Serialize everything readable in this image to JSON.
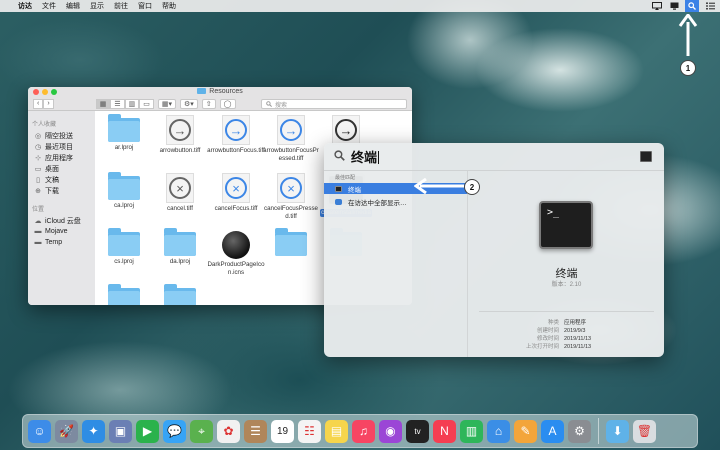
{
  "menubar": {
    "apple": "",
    "items": [
      "访达",
      "文件",
      "编辑",
      "显示",
      "前往",
      "窗口",
      "帮助"
    ]
  },
  "callouts": {
    "one": "1",
    "two": "2"
  },
  "finder": {
    "title": "Resources",
    "search_placeholder": "搜索",
    "sidebar": {
      "favorites_heading": "个人收藏",
      "favorites": [
        {
          "label": "隔空投送",
          "icon": "airdrop-icon"
        },
        {
          "label": "最近项目",
          "icon": "clock-icon"
        },
        {
          "label": "应用程序",
          "icon": "apps-icon"
        },
        {
          "label": "桌面",
          "icon": "desktop-icon"
        },
        {
          "label": "文稿",
          "icon": "document-icon"
        },
        {
          "label": "下载",
          "icon": "download-icon"
        }
      ],
      "locations_heading": "位置",
      "locations": [
        {
          "label": "iCloud 云盘",
          "icon": "cloud-icon"
        },
        {
          "label": "Mojave",
          "icon": "disk-icon"
        },
        {
          "label": "Temp",
          "icon": "disk-icon"
        }
      ]
    },
    "files": [
      {
        "label": "ar.lproj",
        "kind": "folder"
      },
      {
        "label": "arrowbutton.tiff",
        "kind": "tiff-gray"
      },
      {
        "label": "arrowbuttonFocus.tiff",
        "kind": "tiff-blue"
      },
      {
        "label": "arrowbuttonFocusPressed.tiff",
        "kind": "tiff-blue"
      },
      {
        "label": "",
        "kind": "tiff-dark"
      },
      {
        "label": "ca.lproj",
        "kind": "folder"
      },
      {
        "label": "cancel.tiff",
        "kind": "cancel-gray"
      },
      {
        "label": "cancelFocus.tiff",
        "kind": "cancel-blue"
      },
      {
        "label": "cancelFocusPressed.tiff",
        "kind": "cancel-blue"
      },
      {
        "label": "createinstallmedia",
        "kind": "exec"
      },
      {
        "label": "cs.lproj",
        "kind": "folder"
      },
      {
        "label": "da.lproj",
        "kind": "folder"
      },
      {
        "label": "DarkProductPageIcon.icns",
        "kind": "icns"
      },
      {
        "label": "",
        "kind": "folder"
      },
      {
        "label": "",
        "kind": "folder"
      },
      {
        "label": "",
        "kind": "folder"
      },
      {
        "label": "",
        "kind": "folder"
      }
    ]
  },
  "spotlight": {
    "query": "终端",
    "category": "最佳匹配",
    "results": [
      {
        "label": "终端",
        "selected": true
      },
      {
        "label": "在访达中全部显示…",
        "selected": false
      }
    ],
    "preview": {
      "name": "终端",
      "version": "版本：2.10",
      "meta": [
        {
          "k": "种类",
          "v": "应用程序"
        },
        {
          "k": "创建时间",
          "v": "2019/9/3"
        },
        {
          "k": "修改时间",
          "v": "2019/11/13"
        },
        {
          "k": "上次打开时间",
          "v": "2019/11/13"
        }
      ]
    }
  },
  "dock": {
    "apps": [
      {
        "name": "finder-icon",
        "color": "#3d8ce8",
        "glyph": "☺"
      },
      {
        "name": "launchpad-icon",
        "color": "#7d8aa0",
        "glyph": "🚀"
      },
      {
        "name": "safari-icon",
        "color": "#2f8de4",
        "glyph": "✦"
      },
      {
        "name": "photo-booth-icon",
        "color": "#6b7fb4",
        "glyph": "▣"
      },
      {
        "name": "facetime-icon",
        "color": "#2bb24c",
        "glyph": "▶"
      },
      {
        "name": "messages-icon",
        "color": "#37a4f5",
        "glyph": "💬"
      },
      {
        "name": "maps-icon",
        "color": "#5ab14e",
        "glyph": "⌖"
      },
      {
        "name": "photos-icon",
        "color": "#f1f1f1",
        "glyph": "✿"
      },
      {
        "name": "contacts-icon",
        "color": "#b0865a",
        "glyph": "☰"
      },
      {
        "name": "calendar-icon",
        "color": "#ffffff",
        "glyph": "19"
      },
      {
        "name": "reminders-icon",
        "color": "#f4f4f4",
        "glyph": "☷"
      },
      {
        "name": "notes-icon",
        "color": "#f6d54c",
        "glyph": "▤"
      },
      {
        "name": "music-icon",
        "color": "#f74563",
        "glyph": "♫"
      },
      {
        "name": "podcasts-icon",
        "color": "#9b46d6",
        "glyph": "◉"
      },
      {
        "name": "tv-icon",
        "color": "#222222",
        "glyph": "tv"
      },
      {
        "name": "news-icon",
        "color": "#f53e52",
        "glyph": "N"
      },
      {
        "name": "numbers-icon",
        "color": "#2eb65a",
        "glyph": "▥"
      },
      {
        "name": "keynote-icon",
        "color": "#3b8ee6",
        "glyph": "⌂"
      },
      {
        "name": "pages-icon",
        "color": "#f3a53a",
        "glyph": "✎"
      },
      {
        "name": "app-store-icon",
        "color": "#2a8df0",
        "glyph": "A"
      },
      {
        "name": "system-preferences-icon",
        "color": "#8a8d92",
        "glyph": "⚙"
      },
      {
        "name": "downloads-stack-icon",
        "color": "#5fb2e8",
        "glyph": "⬇"
      },
      {
        "name": "trash-icon",
        "color": "#d9dde0",
        "glyph": "🗑"
      }
    ]
  }
}
